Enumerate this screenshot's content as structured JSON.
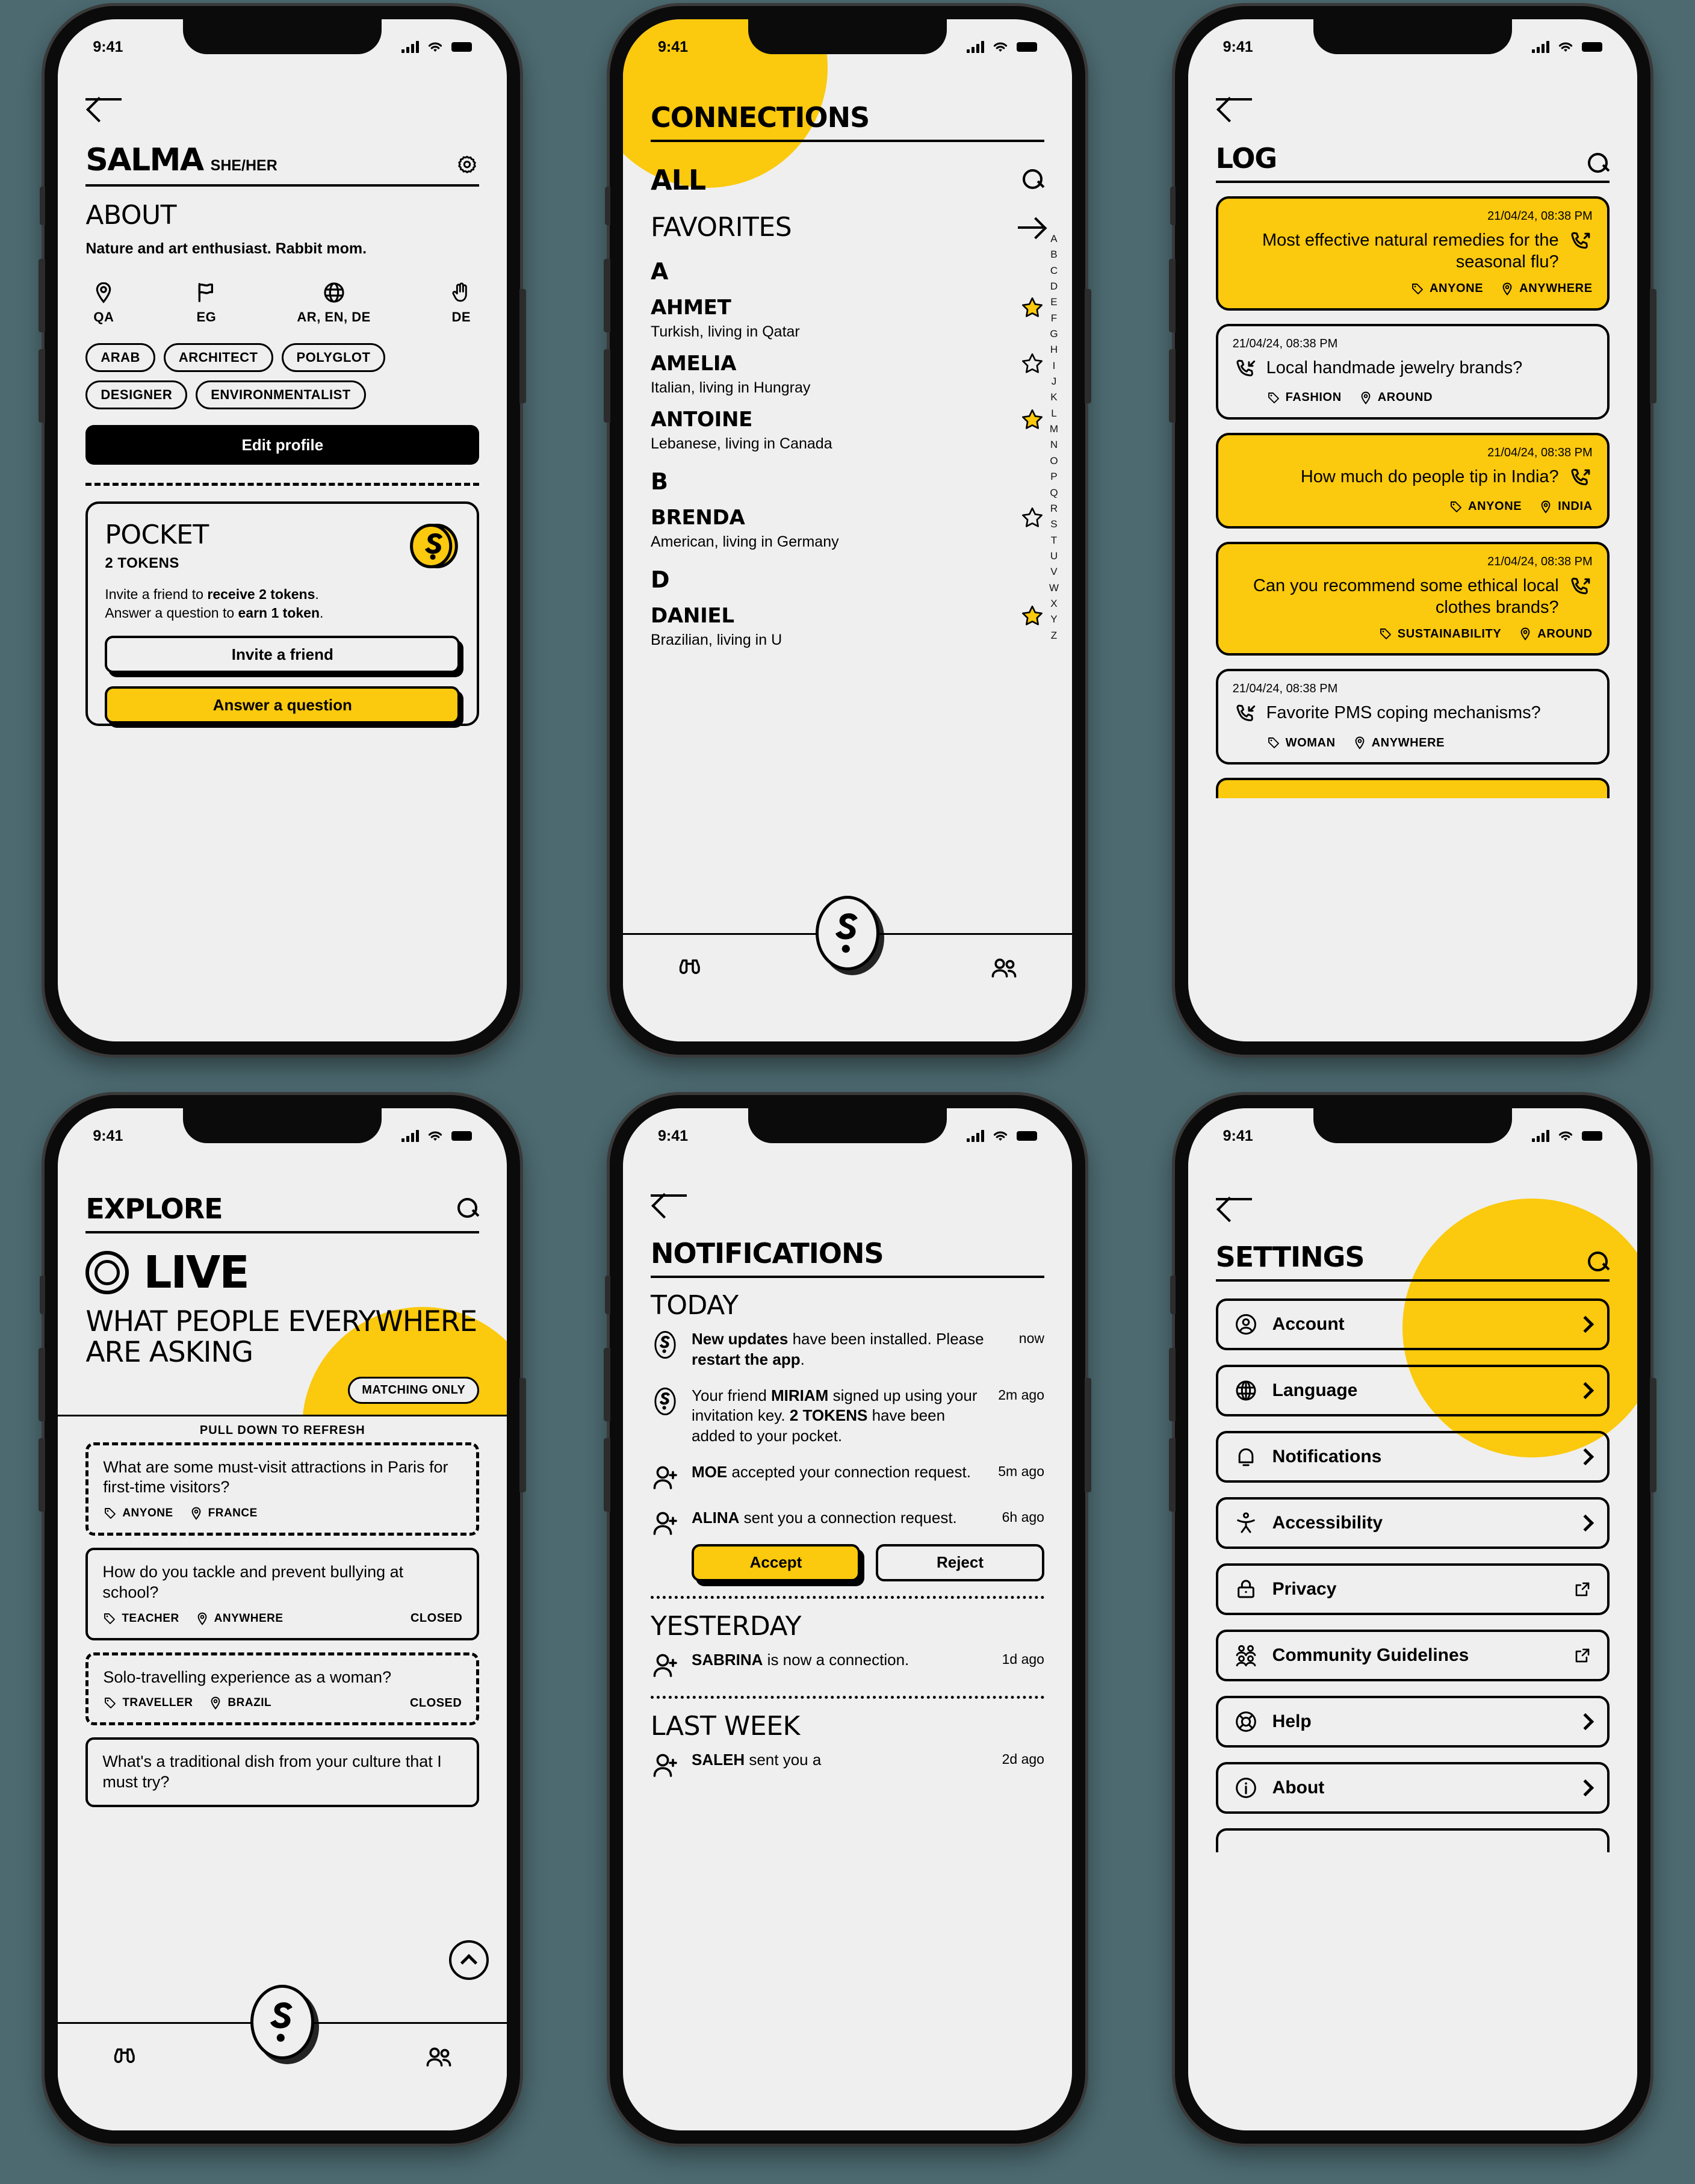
{
  "status_bar": {
    "time": "9:41",
    "signal_icon": "cellular-signal-icon",
    "wifi_icon": "wifi-icon",
    "battery_icon": "battery-icon"
  },
  "brand": {
    "accent_yellow": "#FBC90D",
    "background": "#efefef",
    "ink": "#000000",
    "logo": "S"
  },
  "profile": {
    "back_icon": "back-arrow-icon",
    "name": "SALMA",
    "pronouns": "SHE/HER",
    "gear_icon": "gear-icon",
    "about_heading": "ABOUT",
    "about_text": "Nature and art enthusiast. Rabbit mom.",
    "facts": [
      {
        "icon": "location-pin-icon",
        "label": "QA"
      },
      {
        "icon": "flag-icon",
        "label": "EG"
      },
      {
        "icon": "globe-icon",
        "label": "AR, EN, DE"
      },
      {
        "icon": "sign-language-icon",
        "label": "DE"
      }
    ],
    "tags": [
      "ARAB",
      "ARCHITECT",
      "POLYGLOT",
      "DESIGNER",
      "ENVIRONMENTALIST"
    ],
    "edit_profile_label": "Edit profile",
    "pocket": {
      "title": "POCKET",
      "tokens_label": "2 TOKENS",
      "coin_icon": "token-coin-icon",
      "desc_line1_pre": "Invite a friend to ",
      "desc_line1_bold": "receive 2 tokens",
      "desc_line1_post": ".",
      "desc_line2_pre": "Answer a question to ",
      "desc_line2_bold": "earn 1 token",
      "desc_line2_post": ".",
      "invite_label": "Invite a friend",
      "answer_label": "Answer a question"
    }
  },
  "connections": {
    "title": "CONNECTIONS",
    "tab_all": "ALL",
    "search_icon": "search-icon",
    "favorites_label": "FAVORITES",
    "favorites_arrow_icon": "arrow-right-icon",
    "alphabet": [
      "A",
      "B",
      "C",
      "D",
      "E",
      "F",
      "G",
      "H",
      "I",
      "J",
      "K",
      "L",
      "M",
      "N",
      "O",
      "P",
      "Q",
      "R",
      "S",
      "T",
      "U",
      "V",
      "W",
      "X",
      "Y",
      "Z"
    ],
    "groups": [
      {
        "letter": "A",
        "people": [
          {
            "name": "AHMET",
            "desc": "Turkish, living in Qatar",
            "favorite": true
          },
          {
            "name": "AMELIA",
            "desc": "Italian, living in Hungray",
            "favorite": false
          },
          {
            "name": "ANTOINE",
            "desc": "Lebanese, living in Canada",
            "favorite": true
          }
        ]
      },
      {
        "letter": "B",
        "people": [
          {
            "name": "BRENDA",
            "desc": "American, living in Germany",
            "favorite": false
          }
        ]
      },
      {
        "letter": "D",
        "people": [
          {
            "name": "DANIEL",
            "desc": "Brazilian, living in U",
            "favorite": true
          }
        ]
      }
    ],
    "tabbar": {
      "explore_icon": "binoculars-icon",
      "connections_icon": "people-icon",
      "center_icon": "logo-ask-icon"
    }
  },
  "log": {
    "back_icon": "back-arrow-icon",
    "title": "LOG",
    "search_icon": "search-icon",
    "entries": [
      {
        "timestamp": "21/04/24, 08:38 PM",
        "question": "Most effective natural remedies for the seasonal flu?",
        "tag": "ANYONE",
        "place": "ANYWHERE",
        "outgoing": true,
        "icon": "call-outgoing-icon"
      },
      {
        "timestamp": "21/04/24, 08:38 PM",
        "question": "Local handmade jewelry brands?",
        "tag": "FASHION",
        "place": "AROUND",
        "outgoing": false,
        "icon": "call-incoming-icon"
      },
      {
        "timestamp": "21/04/24, 08:38 PM",
        "question": "How much do people tip in India?",
        "tag": "ANYONE",
        "place": "INDIA",
        "outgoing": true,
        "icon": "call-outgoing-icon"
      },
      {
        "timestamp": "21/04/24, 08:38 PM",
        "question": "Can you recommend some ethical local clothes brands?",
        "tag": "SUSTAINABILITY",
        "place": "AROUND",
        "outgoing": true,
        "icon": "call-outgoing-icon"
      },
      {
        "timestamp": "21/04/24, 08:38 PM",
        "question": "Favorite PMS coping mechanisms?",
        "tag": "WOMAN",
        "place": "ANYWHERE",
        "outgoing": false,
        "icon": "call-incoming-icon"
      }
    ]
  },
  "explore": {
    "title": "EXPLORE",
    "search_icon": "search-icon",
    "live_label": "LIVE",
    "live_ring_icon": "live-ring-icon",
    "headline": "WHAT PEOPLE EVERYWHERE ARE ASKING",
    "matching_only_label": "MATCHING ONLY",
    "pull_to_refresh": "PULL DOWN TO REFRESH",
    "scroll_up_icon": "chevron-up-icon",
    "cards": [
      {
        "question": "What are some must-visit attractions in Paris for first-time visitors?",
        "tag": "ANYONE",
        "place": "FRANCE",
        "status": "",
        "dashed": true
      },
      {
        "question": "How do you tackle and prevent bullying at school?",
        "tag": "TEACHER",
        "place": "ANYWHERE",
        "status": "CLOSED",
        "dashed": false
      },
      {
        "question": "Solo-travelling experience as a woman?",
        "tag": "TRAVELLER",
        "place": "BRAZIL",
        "status": "CLOSED",
        "dashed": true
      },
      {
        "question": "What's a traditional dish from your culture that I must try?",
        "tag": "",
        "place": "",
        "status": "",
        "dashed": false
      }
    ],
    "tabbar": {
      "explore_icon": "binoculars-icon",
      "connections_icon": "people-icon",
      "center_icon": "logo-ask-icon"
    }
  },
  "notifications": {
    "back_icon": "back-arrow-icon",
    "title": "NOTIFICATIONS",
    "sections": [
      {
        "label": "TODAY",
        "items": [
          {
            "icon": "logo-ask-icon",
            "pre": "",
            "bold": "New updates",
            "post": " have been installed. Please ",
            "bold2": "restart the app",
            "post2": ".",
            "time": "now",
            "actions": false
          },
          {
            "icon": "logo-ask-icon",
            "pre": "Your friend ",
            "bold": "MIRIAM",
            "post": " signed up using your invitation key. ",
            "bold2": "2 TOKENS",
            "post2": " have been added to your pocket.",
            "time": "2m ago",
            "actions": false
          },
          {
            "icon": "person-add-icon",
            "pre": "",
            "bold": "MOE",
            "post": " accepted your connection request.",
            "bold2": "",
            "post2": "",
            "time": "5m ago",
            "actions": false
          },
          {
            "icon": "person-add-icon",
            "pre": "",
            "bold": "ALINA",
            "post": " sent you a connection request.",
            "bold2": "",
            "post2": "",
            "time": "6h ago",
            "actions": true
          }
        ]
      },
      {
        "label": "YESTERDAY",
        "items": [
          {
            "icon": "person-add-icon",
            "pre": "",
            "bold": "SABRINA",
            "post": " is now a connection.",
            "bold2": "",
            "post2": "",
            "time": "1d ago",
            "actions": false
          }
        ]
      },
      {
        "label": "LAST WEEK",
        "items": [
          {
            "icon": "person-add-icon",
            "pre": "",
            "bold": "SALEH",
            "post": " sent you a",
            "bold2": "",
            "post2": "",
            "time": "2d ago",
            "actions": false
          }
        ]
      }
    ],
    "accept_label": "Accept",
    "reject_label": "Reject"
  },
  "settings": {
    "back_icon": "back-arrow-icon",
    "title": "SETTINGS",
    "search_icon": "search-icon",
    "items": [
      {
        "label": "Account",
        "icon": "account-circle-icon",
        "trailing": "chevron-right-icon"
      },
      {
        "label": "Language",
        "icon": "globe-icon",
        "trailing": "chevron-right-icon"
      },
      {
        "label": "Notifications",
        "icon": "bell-icon",
        "trailing": "chevron-right-icon"
      },
      {
        "label": "Accessibility",
        "icon": "accessibility-icon",
        "trailing": "chevron-right-icon"
      },
      {
        "label": "Privacy",
        "icon": "lock-icon",
        "trailing": "external-link-icon"
      },
      {
        "label": "Community Guidelines",
        "icon": "people-group-icon",
        "trailing": "external-link-icon"
      },
      {
        "label": "Help",
        "icon": "lifebuoy-icon",
        "trailing": "chevron-right-icon"
      },
      {
        "label": "About",
        "icon": "info-icon",
        "trailing": "chevron-right-icon"
      }
    ]
  }
}
